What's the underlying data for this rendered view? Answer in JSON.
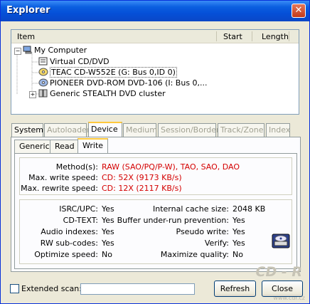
{
  "window": {
    "title": "Explorer",
    "close_glyph": "✕"
  },
  "tree": {
    "columns": {
      "item": "Item",
      "start": "Start",
      "length": "Length"
    },
    "nodes": [
      {
        "label": "My Computer",
        "icon": "computer-icon",
        "expander": "−"
      },
      {
        "label": "Virtual CD/DVD",
        "icon": "virtual-drive-icon"
      },
      {
        "label": "TEAC CD-W552E (G: Bus 0,ID 0)",
        "icon": "cd-drive-icon",
        "selected": true
      },
      {
        "label": "PIONEER DVD-ROM DVD-106 (I: Bus 0,...",
        "icon": "dvd-drive-icon"
      },
      {
        "label": "Generic STEALTH DVD cluster",
        "icon": "cluster-icon",
        "expander": "+"
      }
    ]
  },
  "tabs": [
    {
      "label": "System",
      "state": "normal"
    },
    {
      "label": "Autoloader",
      "state": "disabled"
    },
    {
      "label": "Device",
      "state": "active"
    },
    {
      "label": "Medium",
      "state": "disabled"
    },
    {
      "label": "Session/Border",
      "state": "disabled"
    },
    {
      "label": "Track/Zone",
      "state": "disabled"
    },
    {
      "label": "Index",
      "state": "disabled"
    }
  ],
  "subtabs": [
    {
      "label": "Generic"
    },
    {
      "label": "Read"
    },
    {
      "label": "Write",
      "active": true
    }
  ],
  "write_methods": {
    "methods_label": "Method(s):",
    "methods_value": "RAW (SAO/PQ/P-W), TAO, SAO, DAO",
    "write_speed_label": "Max. write speed:",
    "write_speed_value": "CD: 52X (9173 KB/s)",
    "rewrite_speed_label": "Max. rewrite speed:",
    "rewrite_speed_value": "CD: 12X (2117 KB/s)"
  },
  "features": {
    "left": [
      {
        "label": "ISRC/UPC:",
        "value": "Yes"
      },
      {
        "label": "CD-TEXT:",
        "value": "Yes"
      },
      {
        "label": "Audio indexes:",
        "value": "Yes"
      },
      {
        "label": "RW sub-codes:",
        "value": "Yes"
      },
      {
        "label": "Optimize speed:",
        "value": "No"
      }
    ],
    "right": [
      {
        "label": "Internal cache size:",
        "value": "2048 KB"
      },
      {
        "label": "Buffer under-run prevention:",
        "value": "Yes"
      },
      {
        "label": "Pseudo write:",
        "value": "Yes"
      },
      {
        "label": "Verify:",
        "value": "Yes"
      },
      {
        "label": "Maximize quality:",
        "value": "No"
      }
    ]
  },
  "bottom": {
    "extended_scan_label": "Extended scan:",
    "refresh_label": "Refresh",
    "close_label": "Close"
  },
  "watermark": {
    "text": "CD - R",
    "sub": "www.cdr.cz"
  },
  "colors": {
    "accent_red": "#d40000",
    "title_blue": "#0550d8",
    "tab_highlight": "#ffc83c"
  }
}
